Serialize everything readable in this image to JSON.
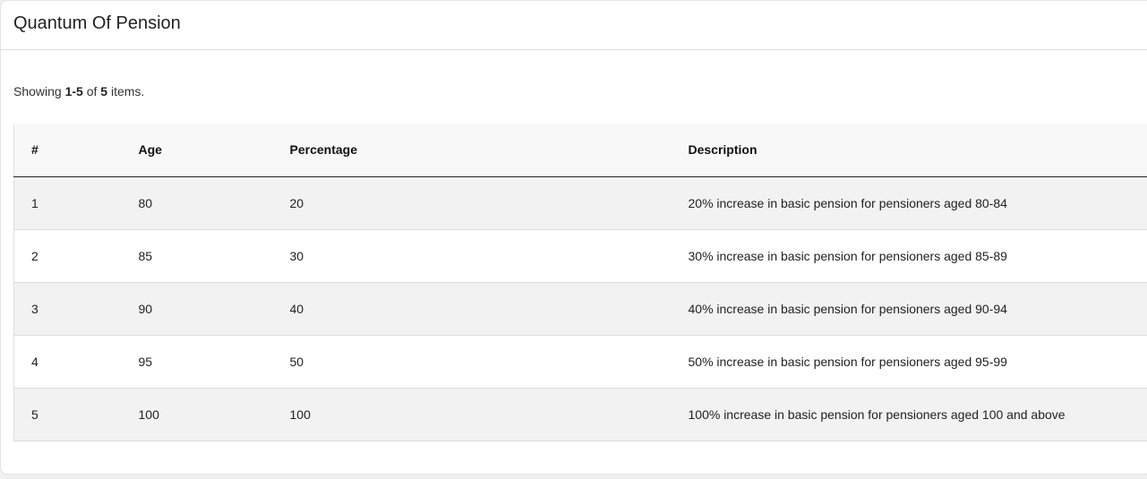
{
  "card": {
    "title": "Quantum Of Pension"
  },
  "summary": {
    "prefix": "Showing ",
    "range": "1-5",
    "of": " of ",
    "total": "5",
    "suffix": " items."
  },
  "table": {
    "headers": [
      "#",
      "Age",
      "Percentage",
      "Description"
    ],
    "rows": [
      [
        "1",
        "80",
        "20",
        "20% increase in basic pension for pensioners aged 80-84"
      ],
      [
        "2",
        "85",
        "30",
        "30% increase in basic pension for pensioners aged 85-89"
      ],
      [
        "3",
        "90",
        "40",
        "40% increase in basic pension for pensioners aged 90-94"
      ],
      [
        "4",
        "95",
        "50",
        "50% increase in basic pension for pensioners aged 95-99"
      ],
      [
        "5",
        "100",
        "100",
        "100% increase in basic pension for pensioners aged 100 and above"
      ]
    ]
  }
}
